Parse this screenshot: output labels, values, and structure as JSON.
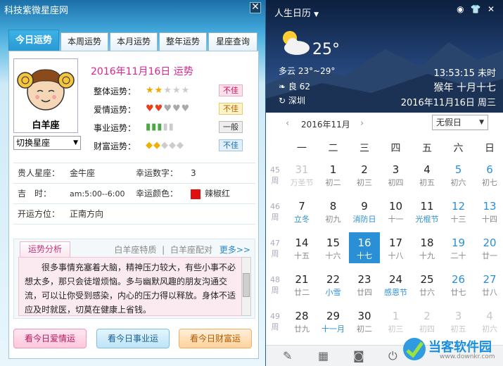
{
  "left": {
    "title": "科技紫微星座网",
    "tabs": [
      "今日运势",
      "本周运势",
      "本月运势",
      "整年运势",
      "星座查询"
    ],
    "sign_name": "白羊座",
    "switch_label": "切换星座",
    "date_title": "2016年11月16日 运势",
    "fortunes": [
      {
        "label": "整体运势：",
        "icons": "★★☆☆☆",
        "status": "不佳"
      },
      {
        "label": "爱情运势：",
        "icons": "♥♥♥♥♥",
        "status": "不佳"
      },
      {
        "label": "事业运势：",
        "icons": "▮▮▮▮▮",
        "status": "一般"
      },
      {
        "label": "财富运势：",
        "icons": "◆◆◆◆◆",
        "status": "不佳"
      }
    ],
    "info": {
      "noble_label": "贵人星座：",
      "noble_value": "金牛座",
      "num_label": "幸运数字：",
      "num_value": "3",
      "time_label": "吉　时：",
      "time_value": "am:5:00--6:00",
      "color_label": "幸运颜色：",
      "color_value": "辣椒红",
      "dir_label": "开运方位：",
      "dir_value": "正南方向"
    },
    "analysis": {
      "tab": "运势分析",
      "link1": "白羊座特质",
      "sep": "|",
      "link2": "白羊座配对",
      "more": "更多>>",
      "text": "　　很多事情充塞着大脑，精神压力较大，有些小事不必想太多，那只会徒增烦恼。多与幽默风趣的朋友沟通交流，可以让你受到感染，内心的压力得以释放。身体不适应及时就医，切莫在健康上省钱。"
    },
    "buttons": {
      "love": "看今日爱情运",
      "career": "看今日事业运",
      "wealth": "看今日财富运"
    },
    "colors": {
      "lucky": "#e01010"
    }
  },
  "right": {
    "title": "人生日历",
    "weather": {
      "temp": "25°",
      "desc": "多云 23°~29°",
      "aqi": "良 62",
      "city": "深圳"
    },
    "clock": "13:53:15 未时",
    "lunar": "猴年 十月十七",
    "gdate": "2016年11月16日 周三",
    "month_label": "2016年11月",
    "holiday_label": "无假日",
    "weekdays": [
      "一",
      "二",
      "三",
      "四",
      "五",
      "六",
      "日"
    ],
    "weeks": [
      {
        "no": "45\n周",
        "days": [
          [
            "31",
            "万圣节",
            "o"
          ],
          [
            "1",
            "初二",
            ""
          ],
          [
            "2",
            "初三",
            ""
          ],
          [
            "3",
            "初四",
            ""
          ],
          [
            "4",
            "初五",
            ""
          ],
          [
            "5",
            "初六",
            "w"
          ],
          [
            "6",
            "初七",
            "w"
          ]
        ]
      },
      {
        "no": "46\n周",
        "days": [
          [
            "7",
            "立冬",
            "f"
          ],
          [
            "8",
            "初九",
            ""
          ],
          [
            "9",
            "消防日",
            "f"
          ],
          [
            "10",
            "十一",
            ""
          ],
          [
            "11",
            "光棍节",
            "f"
          ],
          [
            "12",
            "十三",
            "w"
          ],
          [
            "13",
            "十四",
            "w"
          ]
        ]
      },
      {
        "no": "47\n周",
        "days": [
          [
            "14",
            "十五",
            ""
          ],
          [
            "15",
            "十六",
            ""
          ],
          [
            "16",
            "十七",
            "t"
          ],
          [
            "17",
            "十八",
            ""
          ],
          [
            "18",
            "十九",
            ""
          ],
          [
            "19",
            "二十",
            "w"
          ],
          [
            "20",
            "廿一",
            "w"
          ]
        ]
      },
      {
        "no": "48\n周",
        "days": [
          [
            "21",
            "廿二",
            ""
          ],
          [
            "22",
            "小雪",
            "f"
          ],
          [
            "23",
            "廿四",
            ""
          ],
          [
            "24",
            "感恩节",
            "f"
          ],
          [
            "25",
            "廿六",
            ""
          ],
          [
            "26",
            "廿七",
            "w"
          ],
          [
            "27",
            "廿八",
            "w"
          ]
        ]
      },
      {
        "no": "49\n周",
        "days": [
          [
            "28",
            "廿九",
            ""
          ],
          [
            "29",
            "十一月",
            "f"
          ],
          [
            "30",
            "初二",
            ""
          ],
          [
            "1",
            "初三",
            "o"
          ],
          [
            "2",
            "初四",
            "o"
          ],
          [
            "3",
            "初五",
            "o"
          ],
          [
            "4",
            "初六",
            "o"
          ]
        ]
      }
    ],
    "watermark": "当客软件园",
    "watermark_url": "www.downkr.com"
  }
}
